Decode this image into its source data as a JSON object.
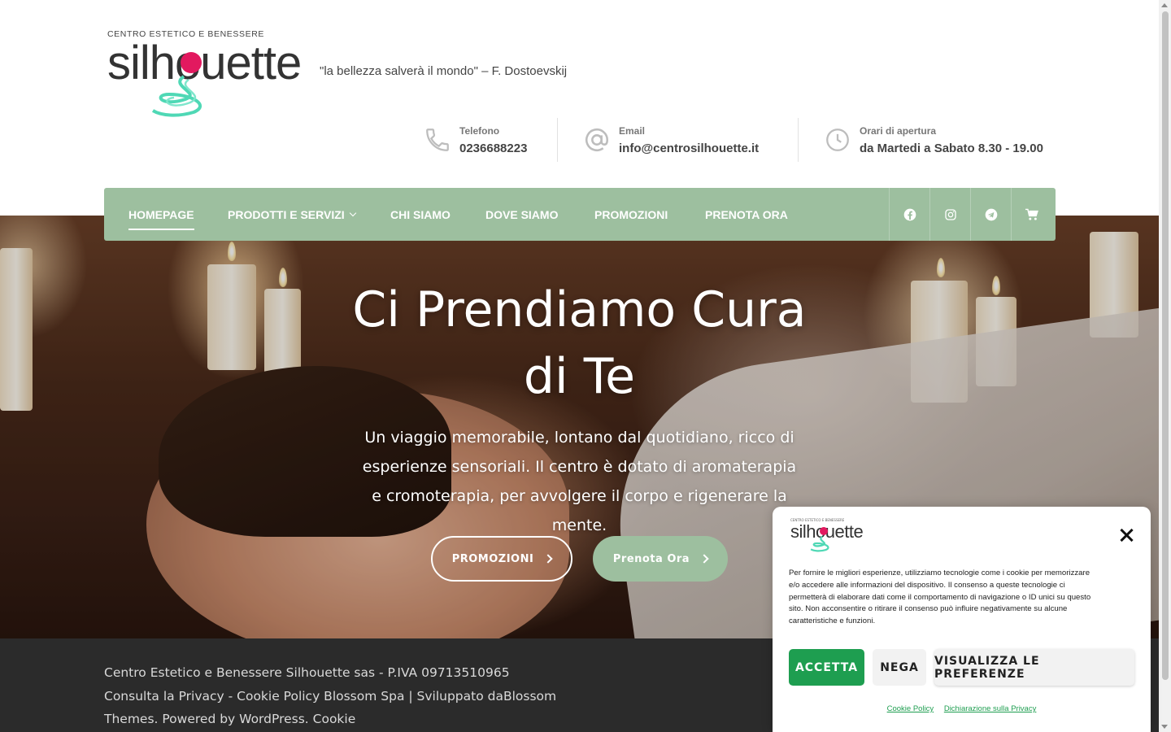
{
  "header": {
    "logo_top_text": "CENTRO ESTETICO E BENESSERE",
    "logo_word": "silhouette",
    "tagline": "\"la bellezza salverà il mondo\" – F. Dostoevskij",
    "contacts": [
      {
        "icon": "phone-icon",
        "label": "Telefono",
        "value": "0236688223"
      },
      {
        "icon": "at-icon",
        "label": "Email",
        "value": "info@centrosilhouette.it"
      },
      {
        "icon": "clock-icon",
        "label": "Orari di apertura",
        "value": "da Martedi a Sabato 8.30 - 19.00"
      }
    ]
  },
  "nav": {
    "items": [
      {
        "label": "HOMEPAGE",
        "active": true
      },
      {
        "label": "PRODOTTI E SERVIZI",
        "has_dropdown": true
      },
      {
        "label": "CHI SIAMO"
      },
      {
        "label": "DOVE SIAMO"
      },
      {
        "label": "PROMOZIONI"
      },
      {
        "label": "PRENOTA ORA"
      }
    ],
    "social": [
      "facebook-icon",
      "instagram-icon",
      "telegram-icon",
      "cart-icon"
    ],
    "color": "#9dbf9f"
  },
  "hero": {
    "title_line1": "Ci Prendiamo Cura",
    "title_line2": "di Te",
    "description": "Un viaggio memorabile, lontano dal quotidiano, ricco di esperienze sensoriali. Il centro è dotato di aromaterapia e cromoterapia, per avvolgere il corpo e rigenerare la mente.",
    "btn_primary": "PROMOZIONI",
    "btn_secondary": "Prenota Ora"
  },
  "footer": {
    "text": "Centro Estetico e Benessere Silhouette sas - P.IVA 09713510965 Consulta la Privacy - Cookie Policy Blossom Spa | Sviluppato daBlossom Themes. Powered by WordPress. Cookie"
  },
  "cookie": {
    "logo_word": "silhouette",
    "text": "Per fornire le migliori esperienze, utilizziamo tecnologie come i cookie per memorizzare e/o accedere alle informazioni del dispositivo. Il consenso a queste tecnologie ci permetterà di elaborare dati come il comportamento di navigazione o ID unici su questo sito. Non acconsentire o ritirare il consenso può influire negativamente su alcune caratteristiche e funzioni.",
    "accept": "ACCETTA",
    "deny": "NEGA",
    "preferences": "VISUALIZZA LE PREFERENZE",
    "link_cookie": "Cookie Policy",
    "link_privacy": "Dichiarazione sulla Privacy",
    "accent": "#1e9e50"
  }
}
